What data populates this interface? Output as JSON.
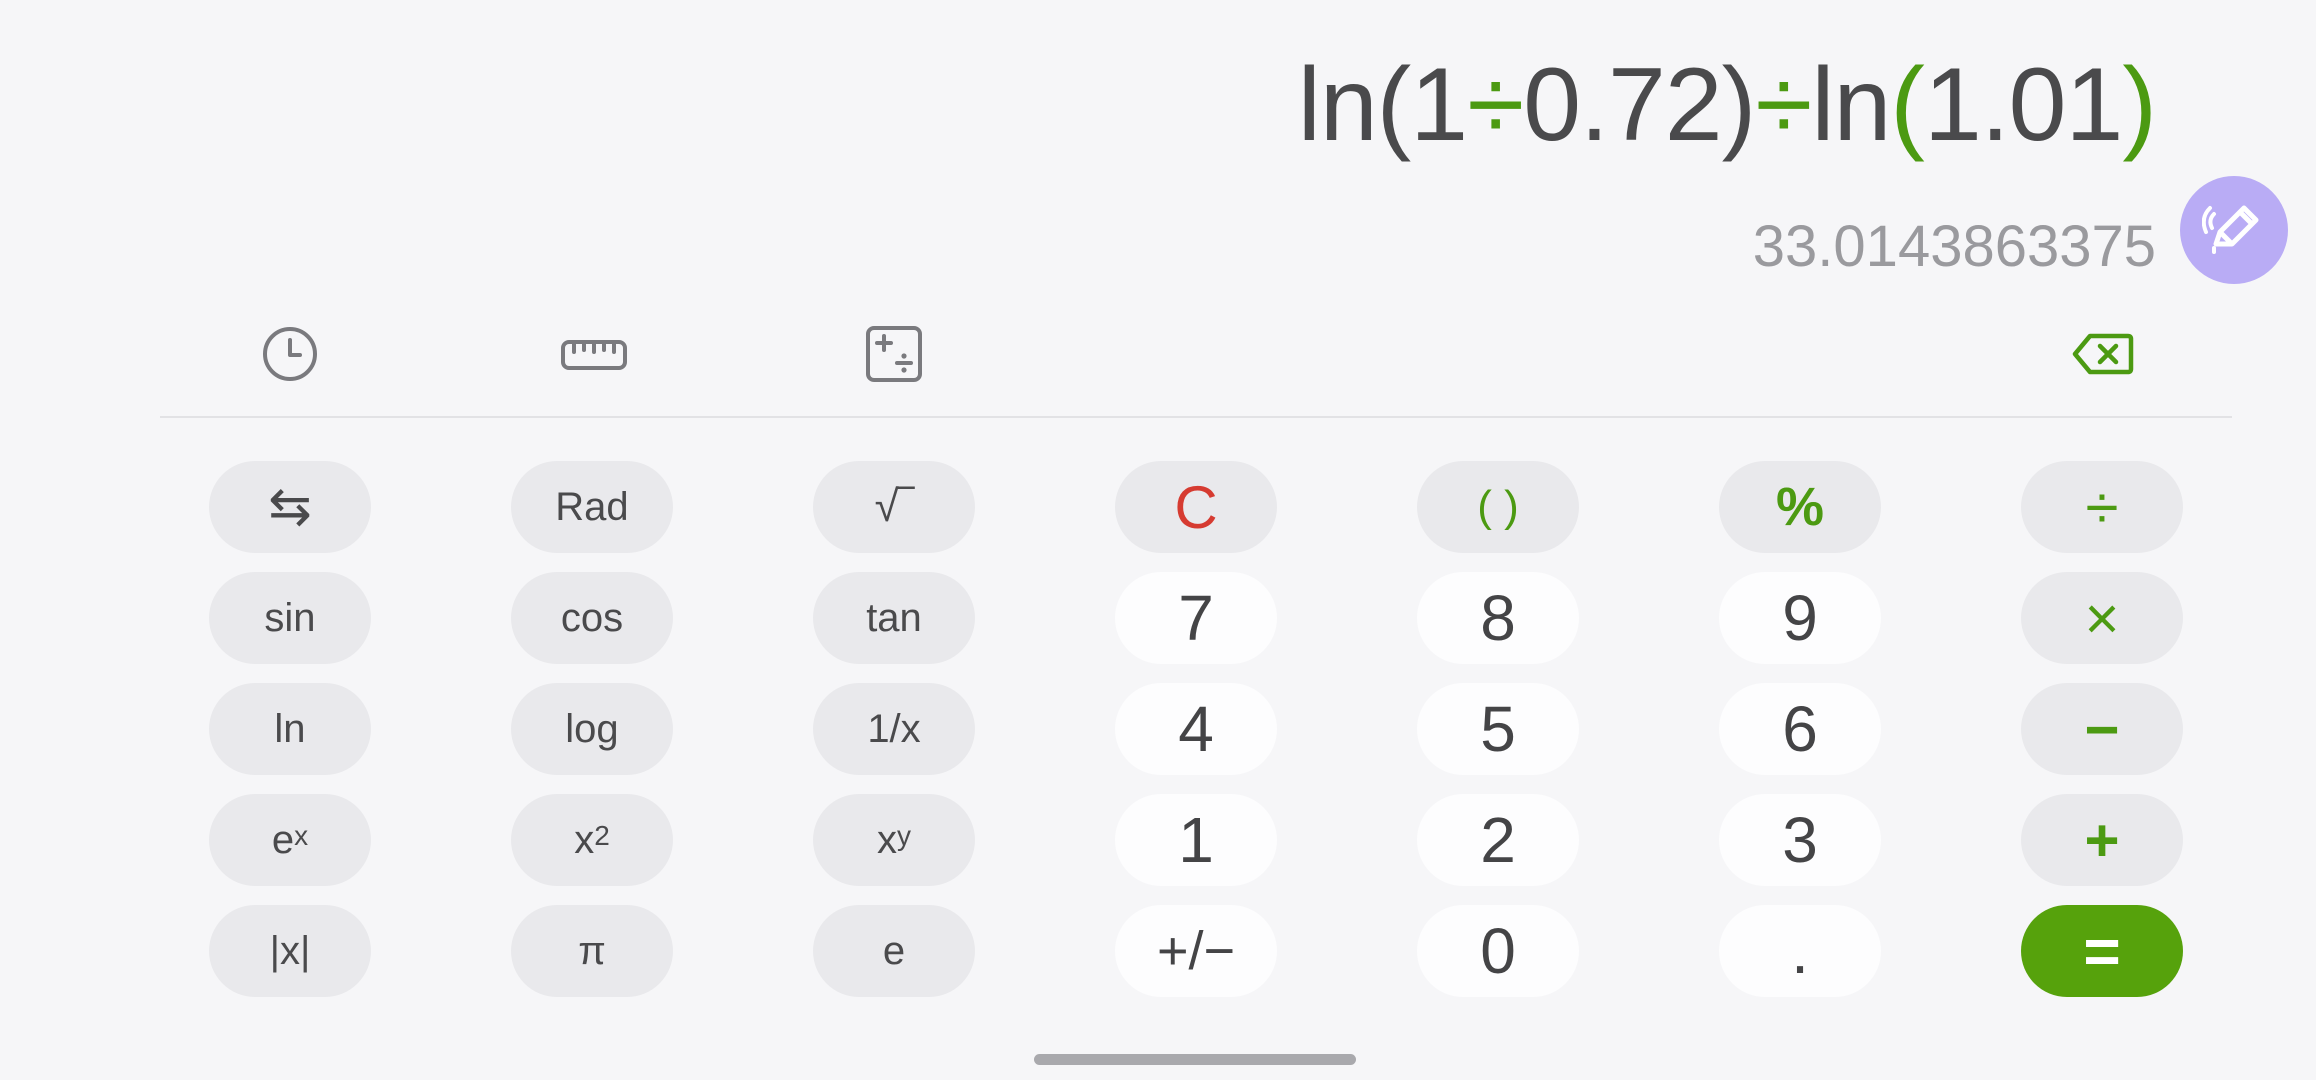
{
  "display": {
    "expression_parts": [
      "ln(1",
      "÷",
      "0.72)",
      "÷",
      "ln",
      "(",
      "1.01",
      ")"
    ],
    "result": "33.0143863375"
  },
  "toolbar": {
    "history_icon": "clock-icon",
    "converter_icon": "ruler-icon",
    "math_icon": "math-symbols-icon",
    "backspace_icon": "backspace-icon"
  },
  "handwrite": {
    "icon": "pen-icon",
    "color": "#b9acf5"
  },
  "keys": {
    "swap": "⇆",
    "rad": "Rad",
    "sqrt": "√‾",
    "clear": "C",
    "parens": "( )",
    "percent": "%",
    "divide": "÷",
    "sin": "sin",
    "cos": "cos",
    "tan": "tan",
    "seven": "7",
    "eight": "8",
    "nine": "9",
    "multiply": "×",
    "ln": "ln",
    "log": "log",
    "reciprocal": "1/x",
    "four": "4",
    "five": "5",
    "six": "6",
    "minus": "−",
    "exp_base": "e",
    "exp_sup": "x",
    "square_base": "x",
    "square_sup": "2",
    "power_base": "x",
    "power_sup": "y",
    "one": "1",
    "two": "2",
    "three": "3",
    "plus": "+",
    "abs": "|x|",
    "pi": "π",
    "e": "e",
    "negate": "+/−",
    "zero": "0",
    "decimal": ".",
    "equals": "="
  },
  "colors": {
    "accent_green": "#4c9a12",
    "equals_green": "#56a20c",
    "clear_red": "#d63b31",
    "background": "#f6f6f8"
  }
}
